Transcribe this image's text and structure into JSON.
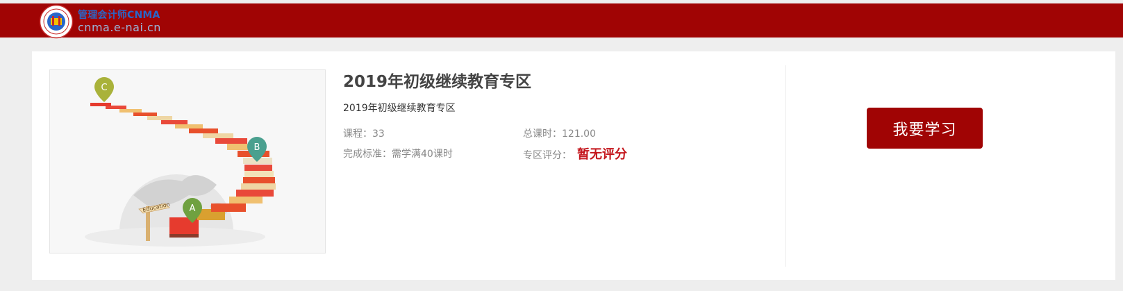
{
  "header": {
    "logo_title": "管理会计师",
    "logo_brand": "CNMA",
    "logo_url": "cnma.e-nai.cn"
  },
  "zone": {
    "title": "2019年初级继续教育专区",
    "subtitle": "2019年初级继续教育专区",
    "courses_label": "课程：",
    "courses_value": "33",
    "total_hours_label": "总课时：",
    "total_hours_value": "121.00",
    "completion_label": "完成标准：",
    "completion_value": "需学满40课时",
    "rating_label": "专区评分：",
    "rating_value": "暂无评分"
  },
  "image": {
    "markers": [
      "C",
      "B",
      "A"
    ],
    "sign_text": "Education"
  },
  "actions": {
    "learn_button": "我要学习"
  },
  "colors": {
    "brand_red": "#a00404",
    "rating_red": "#c4161c",
    "logo_blue": "#2a66c8"
  }
}
